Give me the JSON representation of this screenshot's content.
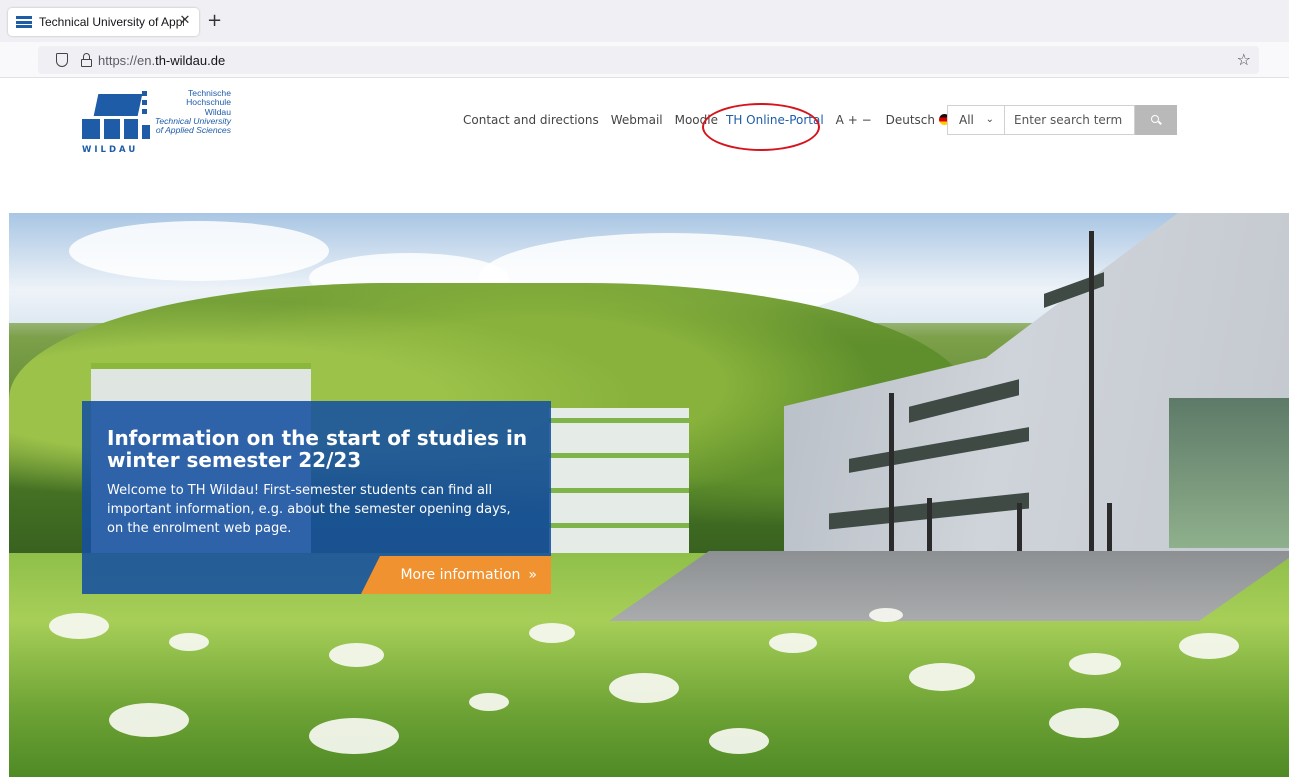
{
  "browser": {
    "tab_title": "Technical University of Applied Sciences Wildau",
    "close_glyph": "✕",
    "newtab_glyph": "+",
    "url_prefix": "https://en.",
    "url_domain": "th-wildau.de",
    "bookmark_glyph": "☆"
  },
  "logo": {
    "line1": "Technische",
    "line2": "Hochschule",
    "line3": "Wildau",
    "line4": "Technical University",
    "line5": "of Applied Sciences",
    "wordmark": "WILDAU",
    "brand_color": "#1e5ca8"
  },
  "topnav": {
    "contact": "Contact and directions",
    "webmail": "Webmail",
    "moodle": "Moodle",
    "portal": "TH Online-Portal",
    "font_size": "A + −",
    "language": "Deutsch"
  },
  "search": {
    "scope": "All",
    "chevron": "⌄",
    "placeholder": "Enter search term"
  },
  "hero": {
    "title": "Information on the start of studies in winter semester 22/23",
    "body": "Welcome to TH Wildau! First-semester students can find all important information, e.g. about the semester opening days, on the enrolment web page.",
    "cta_label": "More information",
    "cta_arrows": "»",
    "box_color": "#1650a0",
    "cta_color": "#f0922f"
  },
  "annotation": {
    "ring_color": "#d6141c"
  }
}
